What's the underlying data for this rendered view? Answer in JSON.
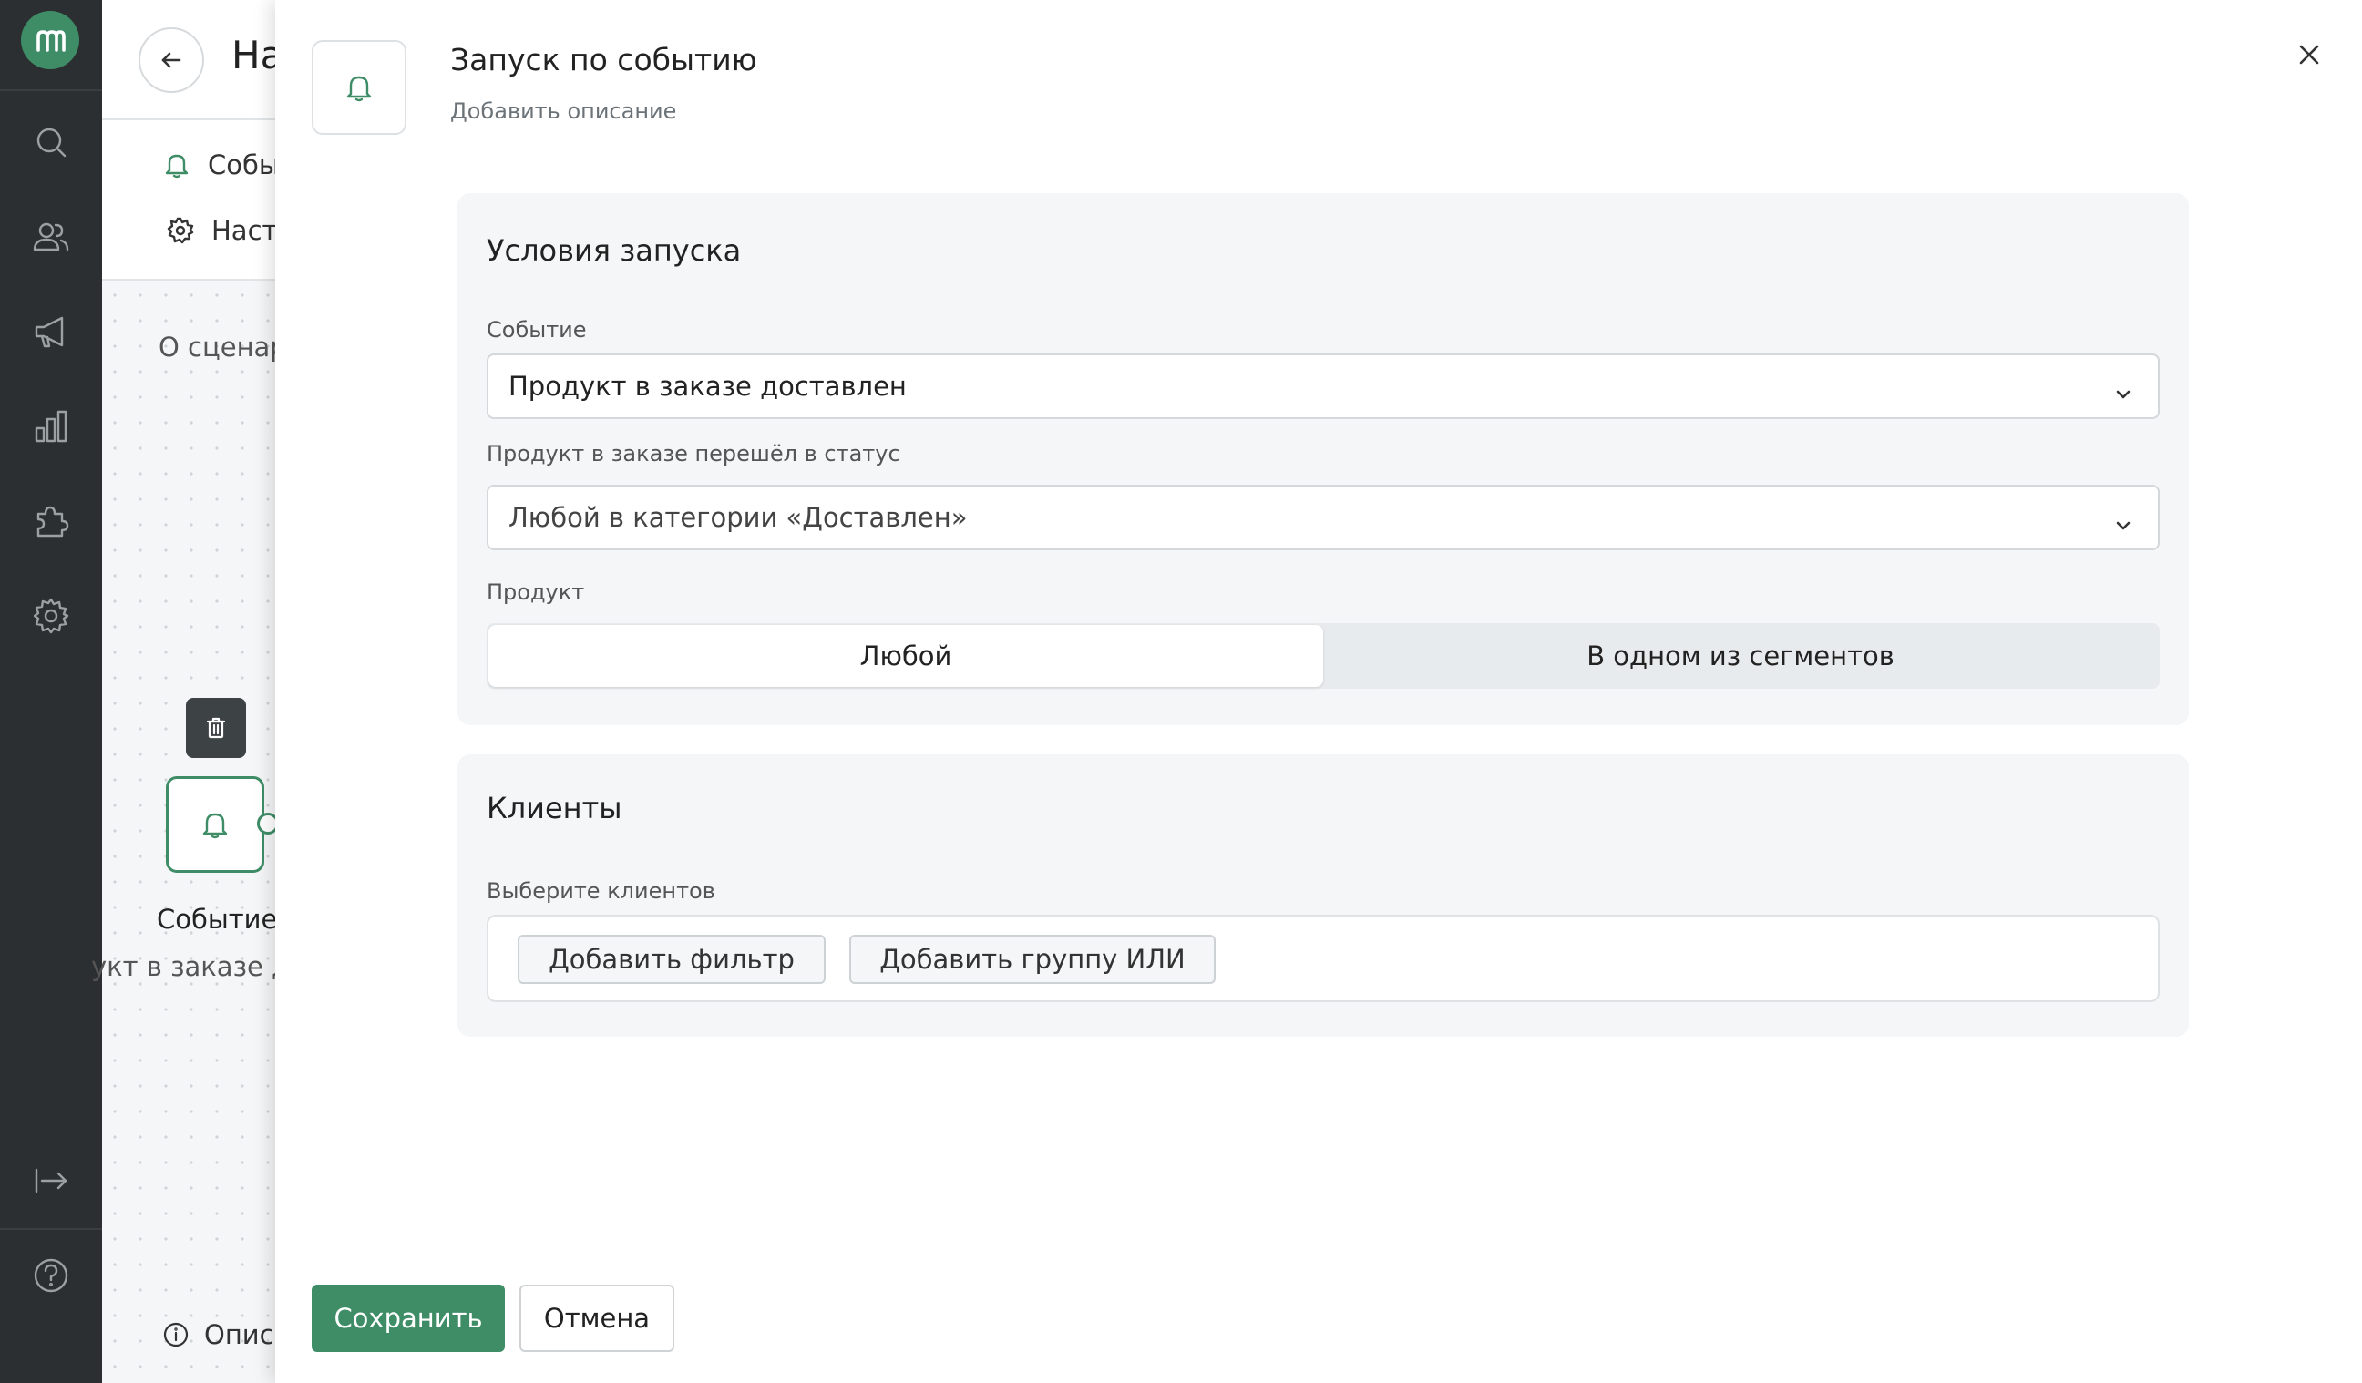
{
  "rail": {
    "logo_letter": "m",
    "icons": [
      "search-icon",
      "users-icon",
      "megaphone-icon",
      "bar-chart-icon",
      "puzzle-icon",
      "gear-icon",
      "collapse-arrow-icon",
      "help-icon"
    ]
  },
  "background": {
    "page_title": "На",
    "subnav": {
      "events_label": "Собы",
      "settings_label": "Настр"
    },
    "about_label": "О сценар",
    "node": {
      "title": "Событие",
      "subtitle": "укт в заказе д"
    },
    "description_label": "Описа"
  },
  "drawer": {
    "title": "Запуск по событию",
    "description": "Добавить описание",
    "launch_conditions": {
      "heading": "Условия запуска",
      "event_label": "Событие",
      "event_value": "Продукт в заказе доставлен",
      "status_label": "Продукт в заказе перешёл в статус",
      "status_value": "Любой в категории «Доставлен»",
      "product_label": "Продукт",
      "product_options": [
        "Любой",
        "В одном из сегментов"
      ],
      "product_selected": "Любой"
    },
    "clients": {
      "heading": "Клиенты",
      "select_label": "Выберите клиентов",
      "add_filter": "Добавить фильтр",
      "add_or_group": "Добавить группу ИЛИ"
    },
    "save_label": "Сохранить",
    "cancel_label": "Отмена"
  },
  "colors": {
    "brand_green": "#3e8d66",
    "rail_bg": "#2b2f31",
    "card_bg": "#f4f6f7"
  }
}
